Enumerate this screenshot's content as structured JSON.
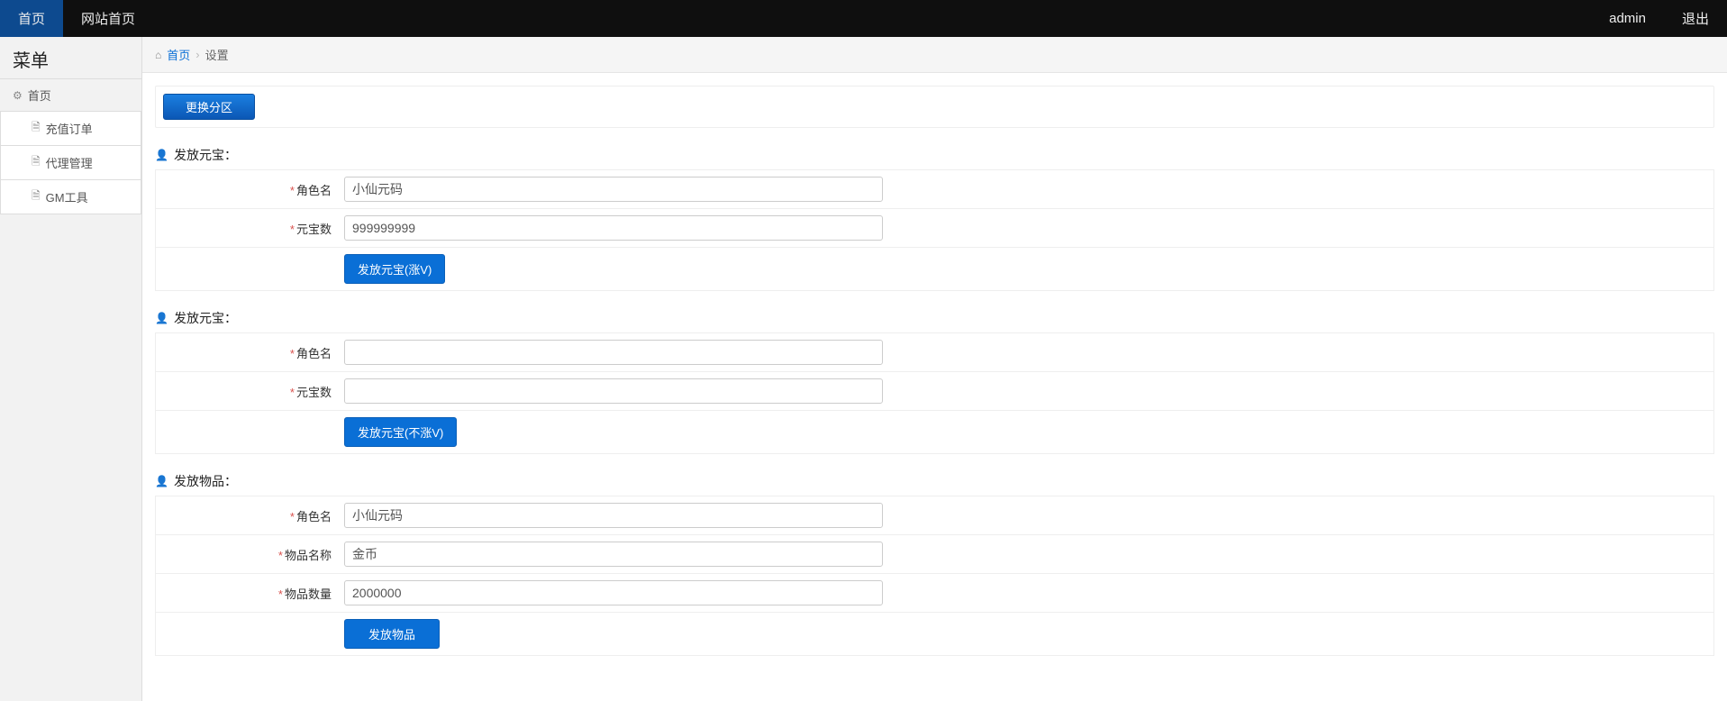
{
  "topnav": {
    "home": "首页",
    "site_home": "网站首页",
    "user": "admin",
    "logout": "退出"
  },
  "sidebar": {
    "title": "菜单",
    "parent": "首页",
    "items": [
      "充值订单",
      "代理管理",
      "GM工具"
    ]
  },
  "breadcrumb": {
    "home": "首页",
    "current": "设置"
  },
  "switch_zone": "更换分区",
  "sections": [
    {
      "title": "发放元宝：",
      "rows": [
        {
          "label": "角色名",
          "value": "小仙元码"
        },
        {
          "label": "元宝数",
          "value": "999999999"
        }
      ],
      "button": "发放元宝(涨V)"
    },
    {
      "title": "发放元宝：",
      "rows": [
        {
          "label": "角色名",
          "value": ""
        },
        {
          "label": "元宝数",
          "value": ""
        }
      ],
      "button": "发放元宝(不涨V)"
    },
    {
      "title": "发放物品：",
      "rows": [
        {
          "label": "角色名",
          "value": "小仙元码"
        },
        {
          "label": "物品名称",
          "value": "金币"
        },
        {
          "label": "物品数量",
          "value": "2000000"
        }
      ],
      "button": "发放物品"
    }
  ]
}
